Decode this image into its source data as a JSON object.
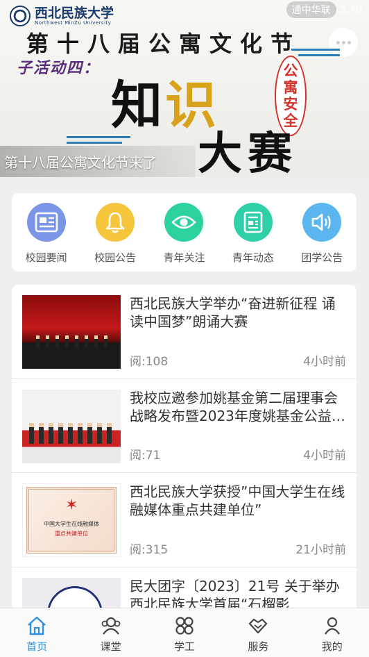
{
  "banner": {
    "logo_cn": "西北民族大学",
    "logo_en": "Northwest MinZu University",
    "status_pill": "通中华联",
    "status_time": "5:40",
    "headline": "第十八届公寓文化节",
    "subheadline": "子活动四：",
    "big_line1_a": "知",
    "big_line1_b": "识",
    "big_line2": "大赛",
    "tag": "公寓安全",
    "caption": "第十八届公寓文化节来了"
  },
  "quick_nav": [
    {
      "label": "校园要闻",
      "icon": "newspaper-icon",
      "color": "#7b95e8"
    },
    {
      "label": "校园公告",
      "icon": "bell-icon",
      "color": "#f5c53b"
    },
    {
      "label": "青年关注",
      "icon": "eye-icon",
      "color": "#2cd1a0"
    },
    {
      "label": "青年动态",
      "icon": "news-grid-icon",
      "color": "#2fcfa9"
    },
    {
      "label": "团学公告",
      "icon": "speaker-icon",
      "color": "#5bb5f0"
    }
  ],
  "news": [
    {
      "title": "西北民族大学举办“奋进新征程 诵读中国梦”朗诵大赛",
      "reads": "阅:108",
      "time": "4小时前"
    },
    {
      "title": "我校应邀参加姚基金第二届理事会战略发布暨2023年度姚基金公益活动",
      "reads": "阅:71",
      "time": "4小时前"
    },
    {
      "title": "西北民族大学获授”中国大学生在线融媒体重点共建单位”",
      "reads": "阅:315",
      "time": "21小时前",
      "thumb_line1": "中国大学生在线融媒体",
      "thumb_line2": "重点共建单位"
    },
    {
      "title": "民大团字〔2023〕21号 关于举办西北民族大学首届“石榴影",
      "reads": "",
      "time": ""
    }
  ],
  "tabs": [
    {
      "label": "首页",
      "icon": "home-icon",
      "active": true
    },
    {
      "label": "课堂",
      "icon": "users-icon",
      "active": false
    },
    {
      "label": "学工",
      "icon": "apps-icon",
      "active": false
    },
    {
      "label": "服务",
      "icon": "handshake-icon",
      "active": false
    },
    {
      "label": "我的",
      "icon": "person-icon",
      "active": false
    }
  ],
  "colors": {
    "accent": "#2f8fe0",
    "text": "#333333",
    "muted": "#888888"
  }
}
